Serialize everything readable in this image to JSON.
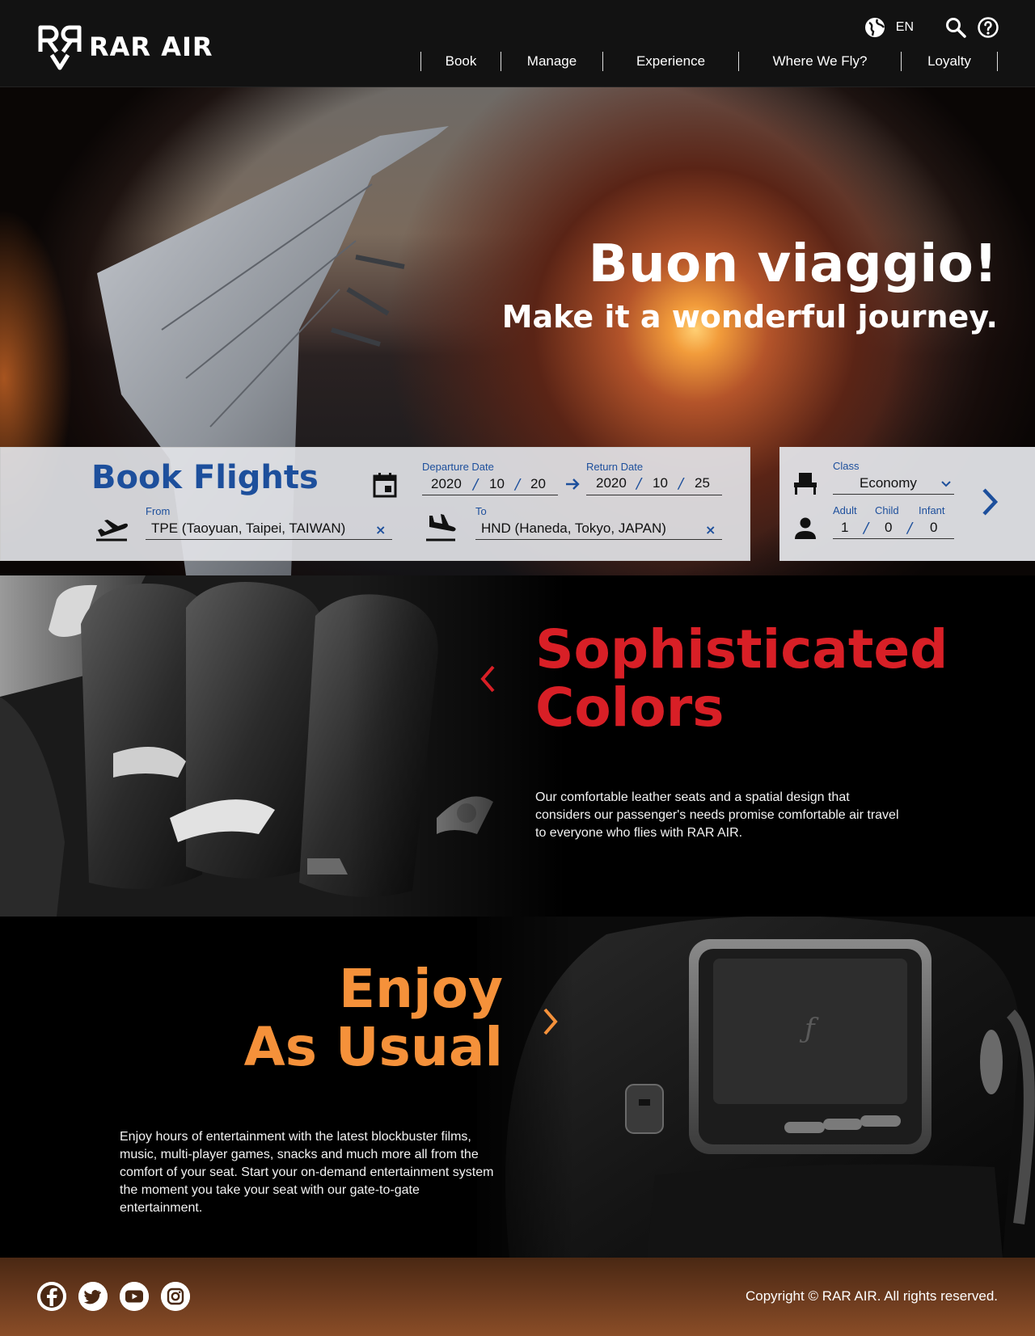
{
  "brand": {
    "name": "RAR AIR"
  },
  "header": {
    "language": "EN",
    "nav": [
      "Book",
      "Manage",
      "Experience",
      "Where We Fly?",
      "Loyalty"
    ]
  },
  "hero": {
    "title": "Buon viaggio!",
    "subtitle": "Make it a wonderful journey."
  },
  "booking": {
    "title": "Book Flights",
    "from": {
      "label": "From",
      "value": "TPE (Taoyuan, Taipei, TAIWAN)"
    },
    "to": {
      "label": "To",
      "value": "HND (Haneda, Tokyo, JAPAN)"
    },
    "departure": {
      "label": "Departure Date",
      "year": "2020",
      "month": "10",
      "day": "20"
    },
    "return": {
      "label": "Return Date",
      "year": "2020",
      "month": "10",
      "day": "25"
    },
    "class": {
      "label": "Class",
      "value": "Economy"
    },
    "passengers": {
      "adult_label": "Adult",
      "adult": "1",
      "child_label": "Child",
      "child": "0",
      "infant_label": "Infant",
      "infant": "0"
    },
    "separator": "/",
    "clear_symbol": "×"
  },
  "section1": {
    "title_line1": "Sophisticated",
    "title_line2": "Colors",
    "text": "Our comfortable leather seats and a spatial design that considers our passenger's needs promise comfortable air travel to everyone who flies with RAR AIR."
  },
  "section2": {
    "title_line1": "Enjoy",
    "title_line2": "As Usual",
    "text": "Enjoy hours of entertainment with the latest blockbuster films, music, multi-player games, snacks and much more all from the comfort of your seat. Start your on-demand entertainment system the moment you take your seat with our gate-to-gate entertainment."
  },
  "footer": {
    "copyright": "Copyright © RAR AIR. All rights reserved.",
    "social": [
      "facebook-icon",
      "twitter-icon",
      "youtube-icon",
      "instagram-icon"
    ]
  },
  "colors": {
    "brand_blue": "#1d4f9c",
    "accent_red": "#d81f26",
    "accent_orange": "#f5913a"
  }
}
